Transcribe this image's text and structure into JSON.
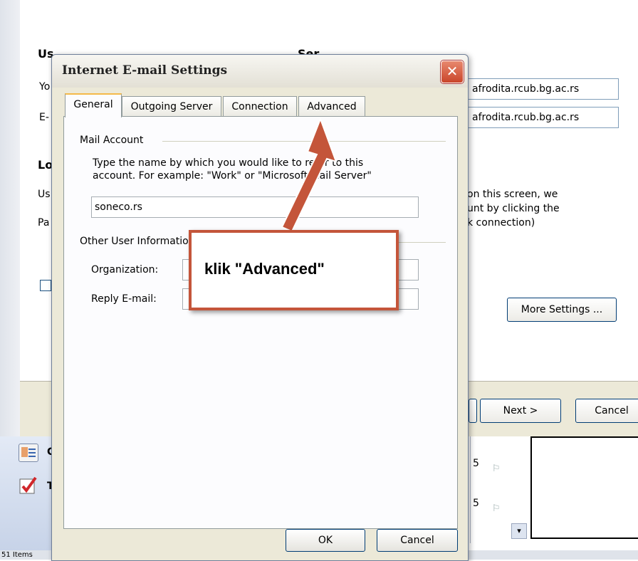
{
  "background_wizard": {
    "section_user_info_partial": "Us",
    "section_server_info_partial": "Ser",
    "label_your_name_partial": "Yo",
    "label_email_partial": "E-",
    "section_logon_partial": "Lo",
    "label_user_name_partial": "Us",
    "label_password_partial": "Pa",
    "incoming_server_value": "afrodita.rcub.bg.ac.rs",
    "outgoing_server_value": "afrodita.rcub.bg.ac.rs",
    "info_text_line1": "on this screen, we",
    "info_text_line2": "unt by clicking the",
    "info_text_line3": "k connection)",
    "more_settings_label": "More Settings ...",
    "next_label": "Next >",
    "cancel_label": "Cancel"
  },
  "outlook": {
    "nav_contacts_partial": "C",
    "nav_tasks_partial": "T",
    "list_row1_num": "5",
    "list_row2_num": "5",
    "status_items": "51 Items"
  },
  "dialog": {
    "title": "Internet E-mail Settings",
    "tabs": [
      {
        "label": "General",
        "active": true
      },
      {
        "label": "Outgoing Server",
        "active": false
      },
      {
        "label": "Connection",
        "active": false
      },
      {
        "label": "Advanced",
        "active": false
      }
    ],
    "mail_account": {
      "group_label": "Mail Account",
      "description_line1": "Type the name by which you would like to refer to this",
      "description_line2": "account.  For example: \"Work\" or \"Microsoft Mail Server\"",
      "account_name_value": "soneco.rs"
    },
    "other_user_info": {
      "group_label": "Other User Information",
      "organization_label": "Organization:",
      "organization_value": "",
      "reply_email_label": "Reply E-mail:",
      "reply_email_value": ""
    },
    "ok_label": "OK",
    "cancel_label": "Cancel"
  },
  "annotation": {
    "callout_text": "klik \"Advanced\"",
    "color": "#c4553a"
  }
}
